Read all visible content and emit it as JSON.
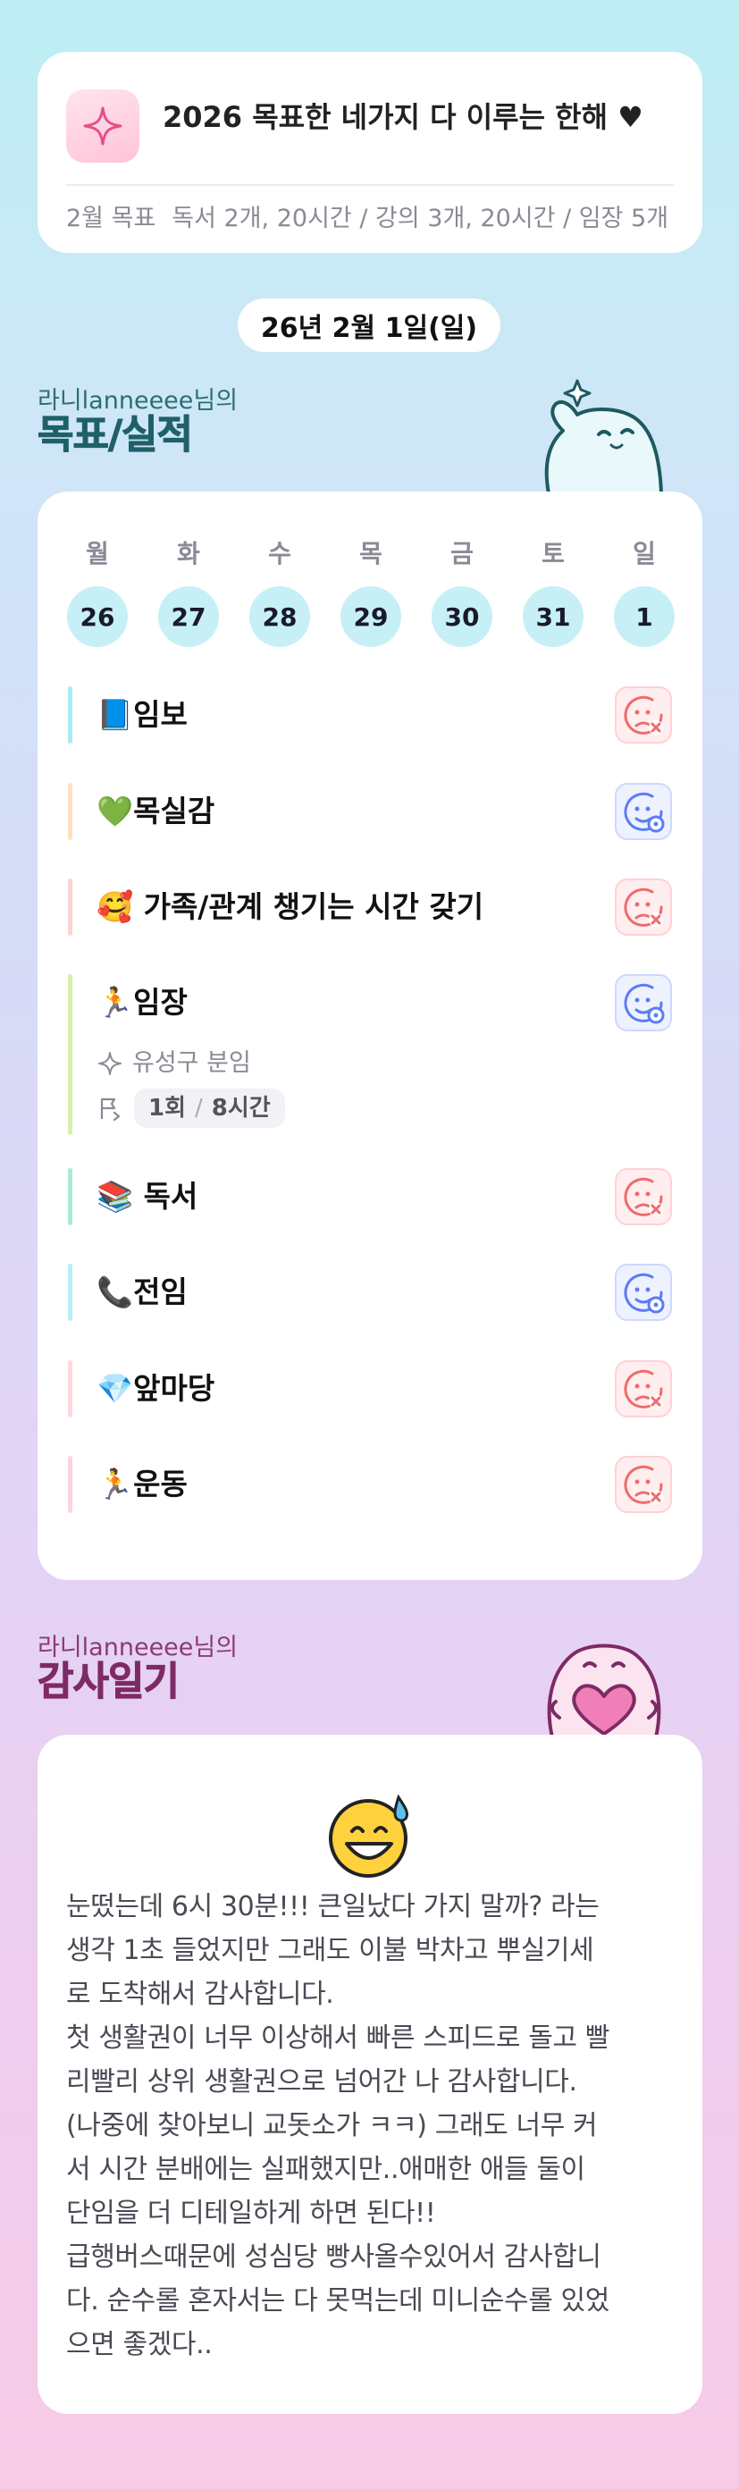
{
  "goal_card": {
    "title": "2026 목표한 네가지 다 이루는 한해 ♥",
    "month_label": "2월 목표",
    "month_goals": "독서 2개, 20시간 / 강의 3개, 20시간 / 임장 5개"
  },
  "date_label": "26년 2월 1일(일)",
  "goals_section": {
    "user_label": "라니lanneeee님의",
    "title": "목표/실적"
  },
  "week": [
    {
      "day": "월",
      "date": "26"
    },
    {
      "day": "화",
      "date": "27"
    },
    {
      "day": "수",
      "date": "28"
    },
    {
      "day": "목",
      "date": "29"
    },
    {
      "day": "금",
      "date": "30"
    },
    {
      "day": "토",
      "date": "31"
    },
    {
      "day": "일",
      "date": "1"
    }
  ],
  "habits": [
    {
      "emoji": "📘",
      "name": "임보",
      "status": "fail",
      "bar_color": "#a8ecf2"
    },
    {
      "emoji": "💚",
      "name": "목실감",
      "status": "ok",
      "bar_color": "#ffe0bd"
    },
    {
      "emoji": "🥰",
      "name": " 가족/관계 챙기는 시간 갖기",
      "status": "fail",
      "bar_color": "#ffd2d2"
    },
    {
      "emoji": "🏃",
      "name": "임장",
      "status": "ok",
      "bar_color": "#d7f2a8",
      "detail": {
        "place": "유성구 분임",
        "count": "1회",
        "hours": "8시간"
      }
    },
    {
      "emoji": "📚",
      "name": " 독서",
      "status": "fail",
      "bar_color": "#a8ecd6"
    },
    {
      "emoji": "📞",
      "name": "전임",
      "status": "ok",
      "bar_color": "#b8eef5"
    },
    {
      "emoji": "💎",
      "name": "앞마당",
      "status": "fail",
      "bar_color": "#ffd9dd"
    },
    {
      "emoji": "🏃",
      "name": "운동",
      "status": "fail",
      "bar_color": "#fcd3e6"
    }
  ],
  "thanks_section": {
    "user_label": "라니lanneeee님의",
    "title": "감사일기"
  },
  "journal": {
    "mood_icon": "grinning-sweat-icon",
    "text": "눈떴는데 6시 30분!!! 큰일났다 가지 말까? 라는\n생각 1초 들었지만 그래도 이불 박차고 뿌실기세\n로 도착해서 감사합니다.\n첫 생활권이 너무 이상해서 빠른 스피드로 돌고 빨\n리빨리 상위 생활권으로 넘어간 나 감사합니다.\n(나중에 찾아보니 교돗소가 ㅋㅋ) 그래도 너무 커\n서 시간 분배에는 실패했지만..애매한 애들 둘이\n단임을 더 디테일하게 하면 된다!!\n급행버스때문에 성심당 빵사올수있어서 감사합니\n다. 순수롤 혼자서는 다 못먹는데 미니순수롤 있었\n으면 좋겠다.."
  },
  "colors": {
    "fail": "#f06b6b",
    "ok": "#5b7cf5",
    "day_circle": "#c6f0f6"
  }
}
